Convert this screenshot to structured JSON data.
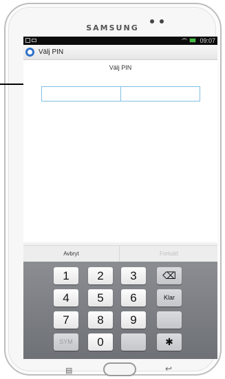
{
  "device": {
    "brand": "SAMSUNG"
  },
  "statusbar": {
    "time": "09:07"
  },
  "app": {
    "title": "Välj PIN"
  },
  "pin": {
    "heading": "Välj PIN",
    "field1_value": "",
    "field2_value": ""
  },
  "actions": {
    "cancel": "Avbryt",
    "continue": "Fortsätt"
  },
  "keyboard": {
    "rows": [
      [
        "1",
        "2",
        "3",
        "⌫"
      ],
      [
        "4",
        "5",
        "6",
        "Klar"
      ],
      [
        "7",
        "8",
        "9",
        ""
      ],
      [
        "SYM",
        "0",
        "",
        "✱"
      ]
    ]
  },
  "navbar": {
    "menu_icon": "menu-icon",
    "home_icon": "home-button",
    "back_icon": "back-icon"
  }
}
